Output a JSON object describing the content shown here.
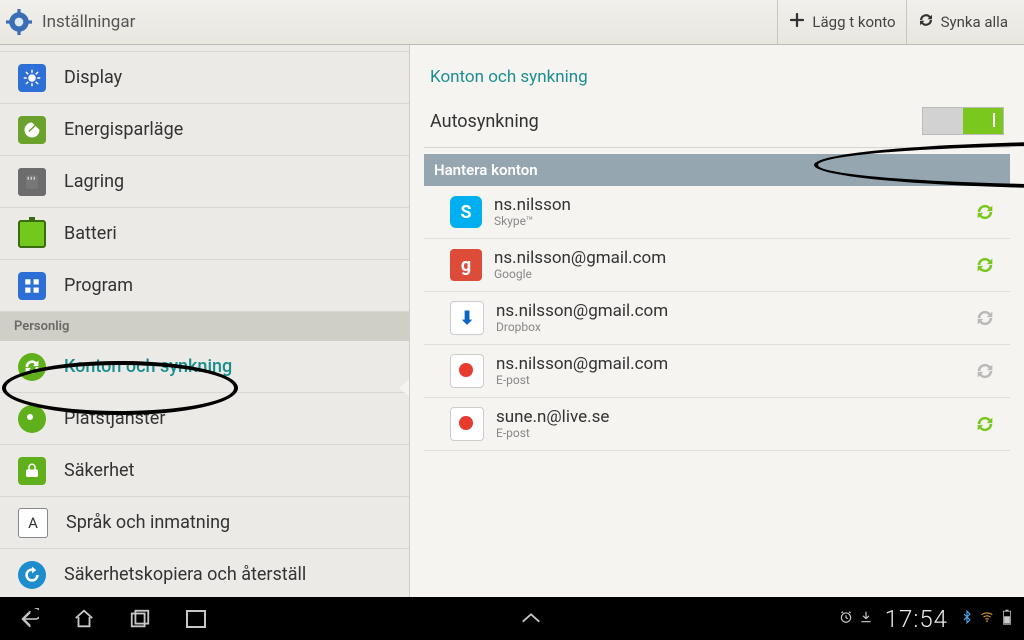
{
  "topbar": {
    "title": "Inställningar",
    "add_label": "Lägg t konto",
    "sync_label": "Synka alla"
  },
  "sidebar": {
    "items": [
      {
        "label": "Display"
      },
      {
        "label": "Energisparläge"
      },
      {
        "label": "Lagring"
      },
      {
        "label": "Batteri"
      },
      {
        "label": "Program"
      }
    ],
    "section_personal": "Personlig",
    "personal": [
      {
        "label": "Konton och synkning"
      },
      {
        "label": "Platstjänster"
      },
      {
        "label": "Säkerhet"
      },
      {
        "label": "Språk och inmatning"
      },
      {
        "label": "Säkerhetskopiera och återställ"
      }
    ]
  },
  "detail": {
    "title": "Konton och synkning",
    "autosync_label": "Autosynkning",
    "manage_header": "Hantera konton"
  },
  "accounts": [
    {
      "name": "ns.nilsson",
      "service": "Skype™",
      "syncing": true
    },
    {
      "name": "ns.nilsson@gmail.com",
      "service": "Google",
      "syncing": true
    },
    {
      "name": "ns.nilsson@gmail.com",
      "service": "Dropbox",
      "syncing": false
    },
    {
      "name": "ns.nilsson@gmail.com",
      "service": "E-post",
      "syncing": false
    },
    {
      "name": "sune.n@live.se",
      "service": "E-post",
      "syncing": true
    }
  ],
  "statusbar": {
    "time": "17:54"
  },
  "icons": {
    "lang_letter": "A"
  }
}
